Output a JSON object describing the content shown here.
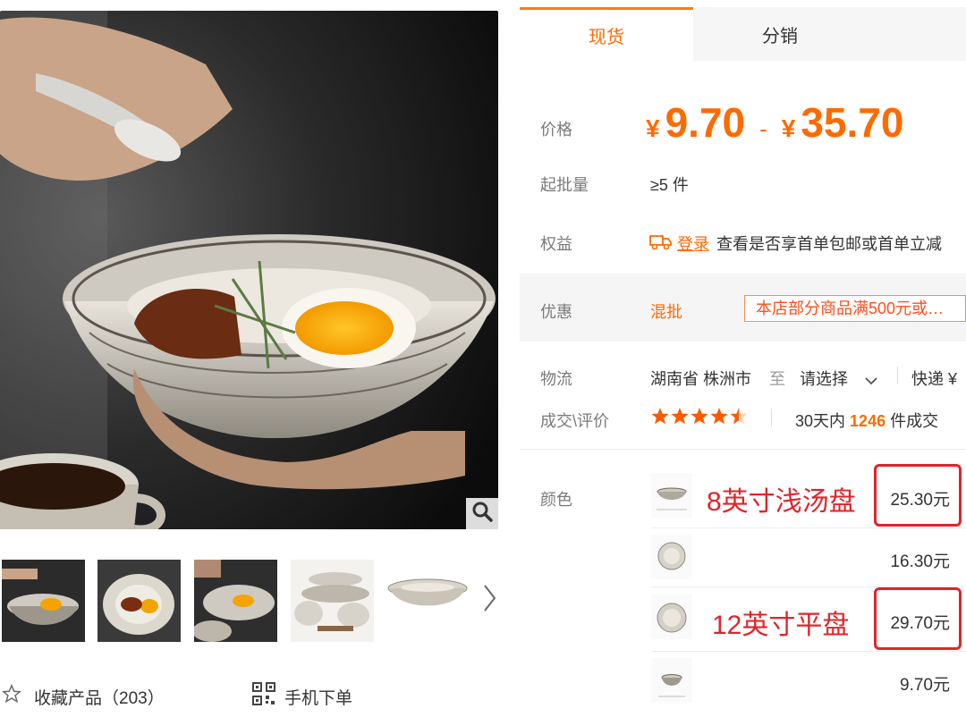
{
  "tabs": [
    {
      "label": "现货",
      "active": true
    },
    {
      "label": "分销",
      "active": false
    }
  ],
  "price": {
    "label": "价格",
    "currency": "¥",
    "min": "9.70",
    "separator": "-",
    "max": "35.70"
  },
  "moq": {
    "label": "起批量",
    "value": "≥5 件"
  },
  "benefits": {
    "label": "权益",
    "login_link": "登录",
    "text": "查看是否享首单包邮或首单立减"
  },
  "promo": {
    "label": "优惠",
    "type": "混批",
    "tag": "本店部分商品满500元或…"
  },
  "logistics": {
    "label": "物流",
    "origin": "湖南省 株洲市",
    "to": "至",
    "dest": "请选择",
    "method": "快递 ¥"
  },
  "deals": {
    "label": "成交\\评价",
    "stars": 4.5,
    "period": "30天内",
    "count": "1246",
    "suffix": "件成交"
  },
  "color": {
    "label": "颜色",
    "skus": [
      {
        "price": "25.30元",
        "annotation": "8英寸浅汤盘",
        "highlighted": true,
        "icon": "shallow-bowl-icon"
      },
      {
        "price": "16.30元",
        "annotation": "",
        "highlighted": false,
        "icon": "plate-icon"
      },
      {
        "price": "29.70元",
        "annotation": "12英寸平盘",
        "highlighted": true,
        "icon": "plate-icon"
      },
      {
        "price": "9.70元",
        "annotation": "",
        "highlighted": false,
        "icon": "small-bowl-icon"
      }
    ]
  },
  "actions": {
    "favorite": "收藏产品（203）",
    "mobile_order": "手机下单"
  },
  "colors": {
    "accent": "#ff6a00",
    "annotation_red": "#e0242a"
  }
}
